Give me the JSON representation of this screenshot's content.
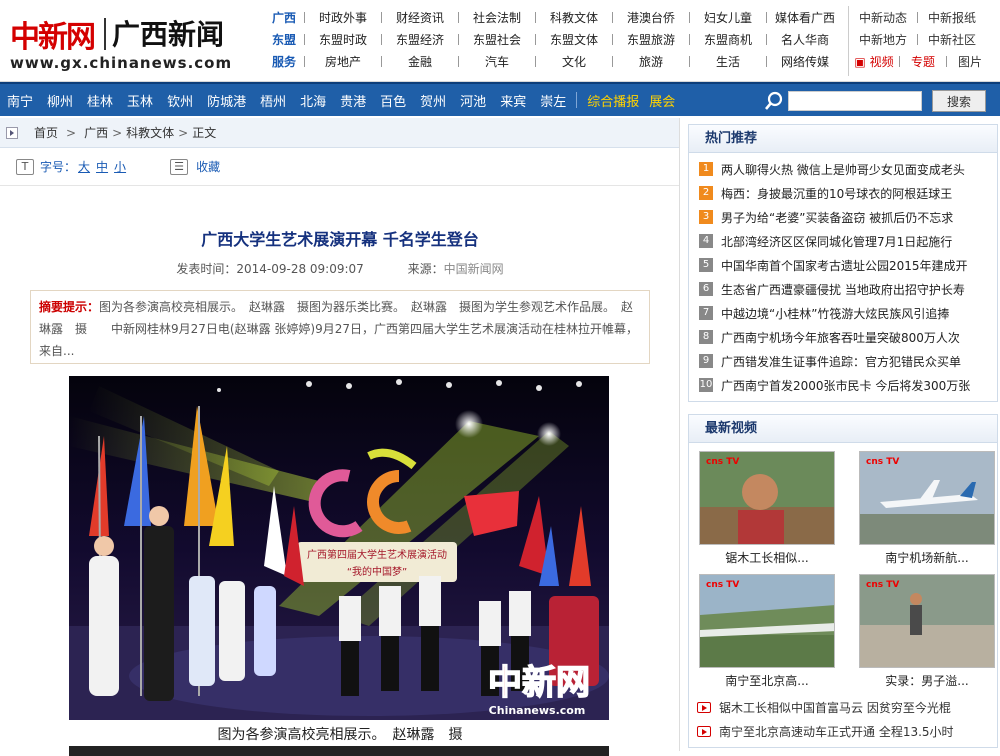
{
  "logo": {
    "cn": "中新网",
    "gx": "广西新闻",
    "url": "www.gx.chinanews.com"
  },
  "nav": {
    "rows": [
      {
        "head": "广西",
        "items": [
          "时政外事",
          "财经资讯",
          "社会法制",
          "科教文体",
          "港澳台侨",
          "妇女儿童",
          "媒体看广西"
        ]
      },
      {
        "head": "东盟",
        "items": [
          "东盟时政",
          "东盟经济",
          "东盟社会",
          "东盟文体",
          "东盟旅游",
          "东盟商机",
          "名人华商"
        ]
      },
      {
        "head": "服务",
        "items": [
          "房地产",
          "金融",
          "汽车",
          "文化",
          "旅游",
          "生活",
          "网络传媒"
        ]
      }
    ],
    "right": [
      [
        "中新动态",
        "中新报纸"
      ],
      [
        "中新地方",
        "中新社区"
      ],
      [
        "视频",
        "专题",
        "图片"
      ]
    ]
  },
  "citybar": {
    "cities": [
      "南宁",
      "柳州",
      "桂林",
      "玉林",
      "钦州",
      "防城港",
      "梧州",
      "北海",
      "贵港",
      "百色",
      "贺州",
      "河池",
      "来宾",
      "崇左"
    ],
    "extra": [
      "综合播报",
      "展会"
    ]
  },
  "search": {
    "placeholder": "",
    "button": "搜索"
  },
  "breadcrumb": [
    "首页",
    "广西",
    "科教文体",
    "正文"
  ],
  "tools": {
    "font_label": "字号：",
    "sizes": [
      "大",
      "中",
      "小"
    ],
    "fav": "收藏"
  },
  "article": {
    "title": "广西大学生艺术展演开幕 千名学生登台",
    "time_label": "发表时间：",
    "time": "2014-09-28 09:09:07",
    "source_label": "来源：",
    "source": "中国新闻网",
    "summary_key": "摘要提示：",
    "summary": "图为各参演高校亮相展示。　赵琳露　摄图为器乐类比赛。　赵琳露　摄图为学生参观艺术作品展。　赵琳露　摄　　中新网桂林9月27日电(赵琳露 张婷婷)9月27日，广西第四届大学生艺术展演活动在桂林拉开帷幕，来自...",
    "caption": "图为各参演高校亮相展示。　赵琳露　摄",
    "watermark": "中新网",
    "watermark_url": "Chinanews.com",
    "banner": "广西第四届大学生艺术展演活动",
    "banner_sub": "“我的中国梦”"
  },
  "hot": {
    "title": "热门推荐",
    "items": [
      "两人聊得火热 微信上是帅哥少女见面变成老头",
      "梅西：身披最沉重的10号球衣的阿根廷球王",
      "男子为给“老婆”买装备盗窃 被抓后仍不忘求",
      "北部湾经济区区保同城化管理7月1日起施行",
      "中国华南首个国家考古遗址公园2015年建成开",
      "生态省广西遭豪疆侵扰 当地政府出招守护长寿",
      "中越边境“小桂林”竹筏游大炫民族风引追捧",
      "广西南宁机场今年旅客吞吐量突破800万人次",
      "广西错发准生证事件追踪：官方犯错民众买单",
      "广西南宁首发2000张市民卡 今后将发300万张"
    ]
  },
  "video": {
    "title": "最新视频",
    "thumbs": [
      {
        "cap": "锯木工长相似...",
        "logo": "cns TV"
      },
      {
        "cap": "南宁机场新航...",
        "logo": "cns TV"
      },
      {
        "cap": "南宁至北京高...",
        "logo": "cns TV"
      },
      {
        "cap": "实录：男子溢...",
        "logo": "cns TV"
      }
    ],
    "list": [
      "锯木工长相似中国首富马云 因贫穷至今光棍",
      "南宁至北京高速动车正式开通 全程13.5小时"
    ]
  }
}
